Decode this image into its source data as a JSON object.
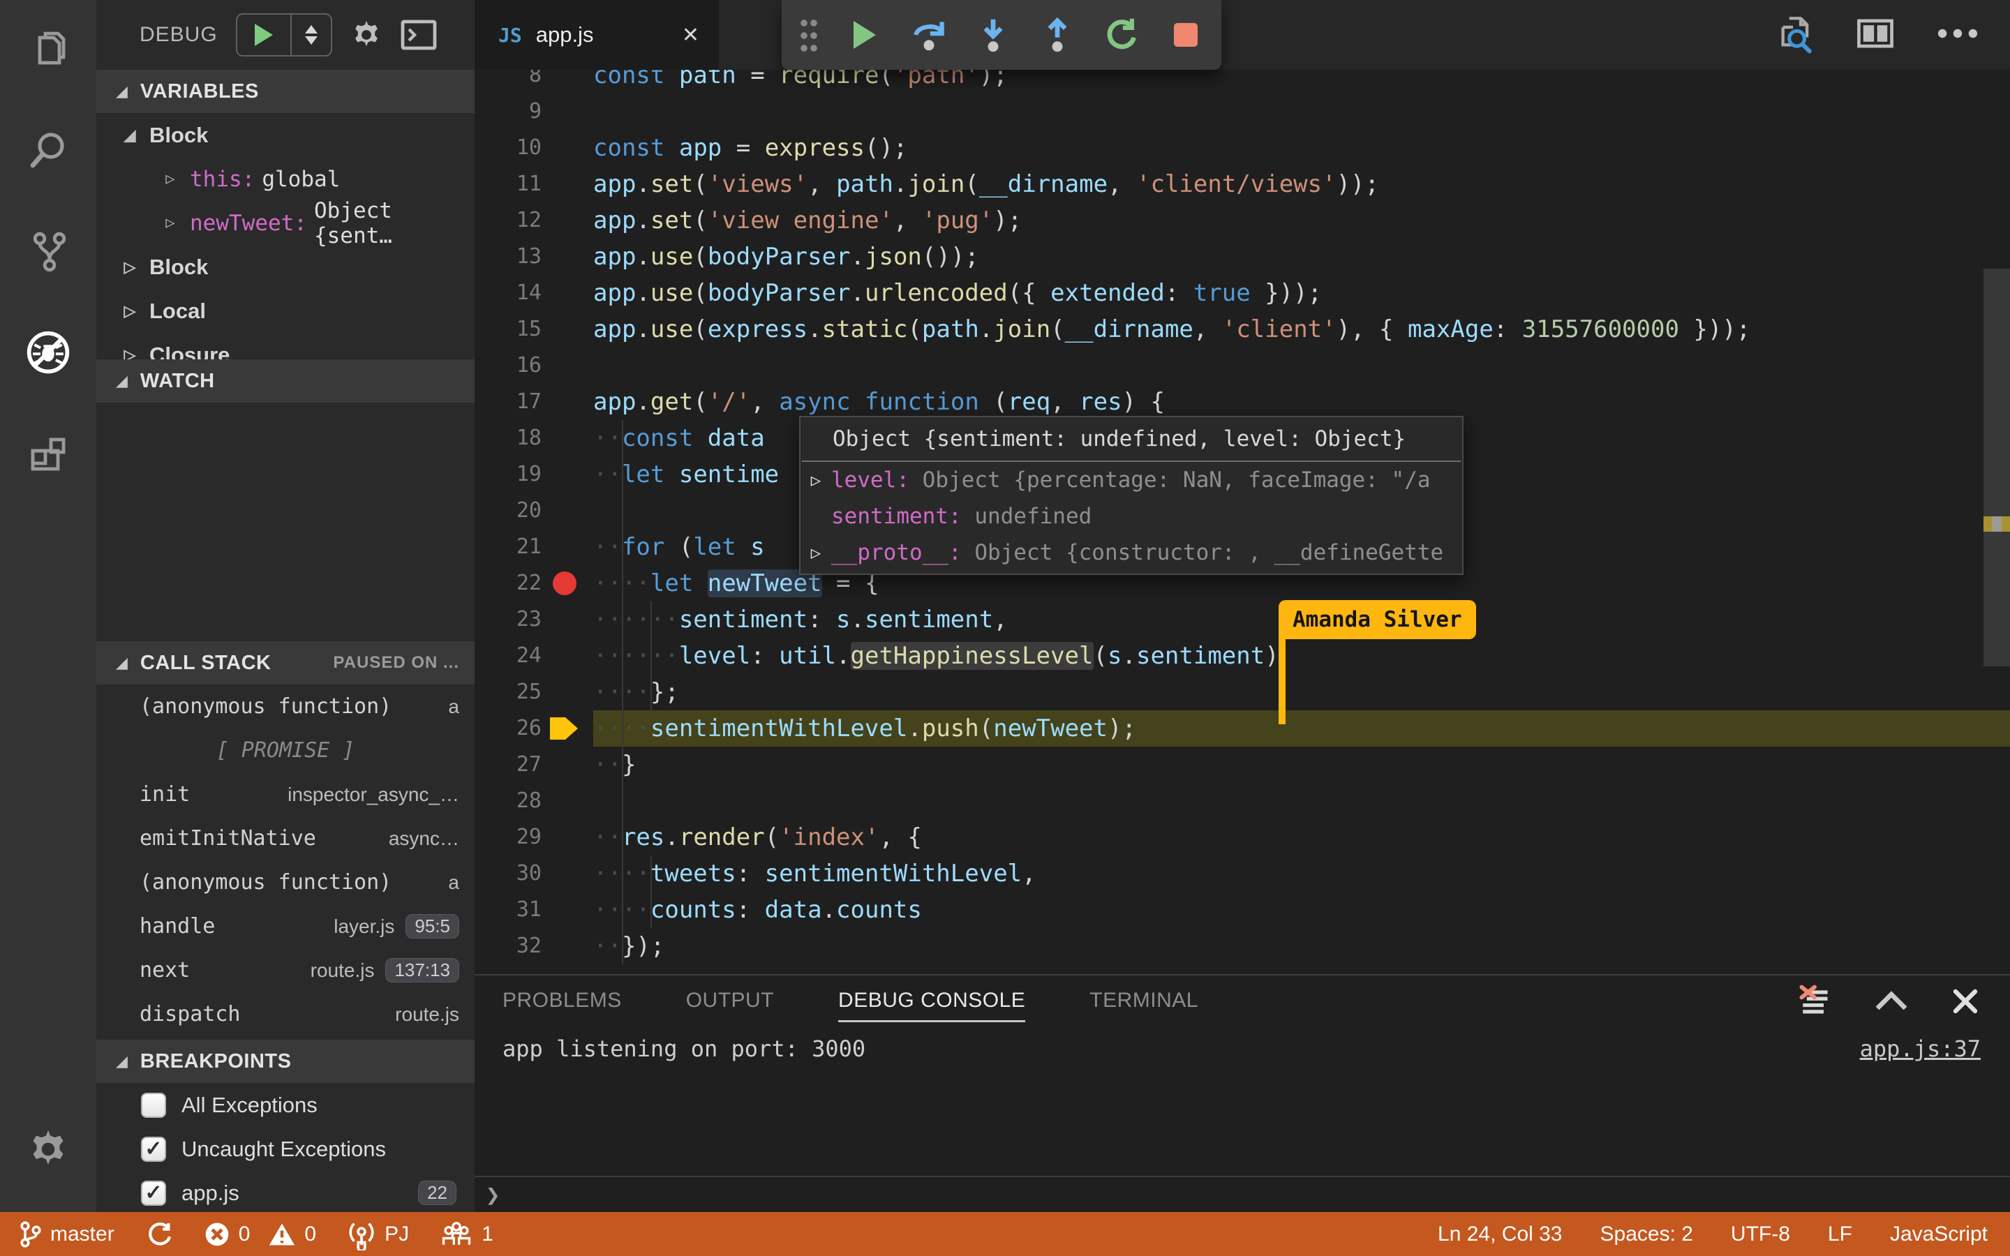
{
  "activity_bar": {
    "items": [
      {
        "icon": "files-icon"
      },
      {
        "icon": "search-icon"
      },
      {
        "icon": "source-control-icon"
      },
      {
        "icon": "debug-icon",
        "active": true
      },
      {
        "icon": "extensions-icon"
      }
    ],
    "settings_icon": "gear-icon"
  },
  "sidebar": {
    "title": "DEBUG",
    "variables": {
      "title": "VARIABLES",
      "rows": [
        {
          "type": "scope",
          "label": "Block",
          "expanded": true
        },
        {
          "type": "var",
          "name": "this:",
          "value": "global"
        },
        {
          "type": "var",
          "name": "newTweet:",
          "value": "Object {sent…"
        },
        {
          "type": "scope",
          "label": "Block",
          "expanded": false
        },
        {
          "type": "scope",
          "label": "Local",
          "expanded": false
        },
        {
          "type": "scope",
          "label": "Closure",
          "expanded": false
        }
      ]
    },
    "watch": {
      "title": "WATCH"
    },
    "call_stack": {
      "title": "CALL STACK",
      "note": "PAUSED ON ...",
      "frames": [
        {
          "name": "(anonymous function)",
          "file": "a",
          "selected": true
        },
        {
          "separator": "[ PROMISE ]"
        },
        {
          "name": "init",
          "file": "inspector_async_…"
        },
        {
          "name": "emitInitNative",
          "file": "async…"
        },
        {
          "name": "(anonymous function)",
          "file": "a"
        },
        {
          "name": "handle",
          "file": "layer.js",
          "badge": "95:5"
        },
        {
          "name": "next",
          "file": "route.js",
          "badge": "137:13"
        },
        {
          "name": "dispatch",
          "file": "route.js"
        }
      ]
    },
    "breakpoints": {
      "title": "BREAKPOINTS",
      "items": [
        {
          "label": "All Exceptions",
          "checked": false
        },
        {
          "label": "Uncaught Exceptions",
          "checked": true
        },
        {
          "label": "app.js",
          "checked": true,
          "badge": "22"
        }
      ]
    }
  },
  "editor": {
    "tab": {
      "icon": "JS",
      "label": "app.js",
      "close": "✕"
    },
    "toolbar_icons": [
      "drag-grip",
      "continue",
      "step-over",
      "step-into",
      "step-out",
      "restart",
      "stop"
    ],
    "action_icons": [
      "open-preview-icon",
      "split-editor-icon",
      "more-actions-icon"
    ],
    "breakpoint_line": 22,
    "current_line": 26,
    "collab_cursor": {
      "name": "Amanda Silver",
      "color": "#ffb710"
    },
    "hover_tooltip": {
      "title": "Object {sentiment: undefined, level: Object}",
      "rows": [
        {
          "twisty": true,
          "name": "level:",
          "value": "Object {percentage: NaN, faceImage: \"/a"
        },
        {
          "twisty": false,
          "name": "sentiment:",
          "value": "undefined"
        },
        {
          "twisty": true,
          "name": "__proto__:",
          "value": "Object {constructor: , __defineGette"
        }
      ]
    },
    "lines": [
      {
        "n": 8,
        "t": [
          [
            "k",
            "const"
          ],
          [
            "p",
            " "
          ],
          [
            "v",
            "path"
          ],
          [
            "p",
            " = "
          ],
          [
            "f",
            "require"
          ],
          [
            "p",
            "("
          ],
          [
            "s",
            "'path'"
          ],
          [
            "p",
            ");"
          ]
        ]
      },
      {
        "n": 9,
        "t": []
      },
      {
        "n": 10,
        "t": [
          [
            "k",
            "const"
          ],
          [
            "p",
            " "
          ],
          [
            "v",
            "app"
          ],
          [
            "p",
            " = "
          ],
          [
            "f",
            "express"
          ],
          [
            "p",
            "();"
          ]
        ]
      },
      {
        "n": 11,
        "t": [
          [
            "v",
            "app"
          ],
          [
            "p",
            "."
          ],
          [
            "f",
            "set"
          ],
          [
            "p",
            "("
          ],
          [
            "s",
            "'views'"
          ],
          [
            "p",
            ", "
          ],
          [
            "v",
            "path"
          ],
          [
            "p",
            "."
          ],
          [
            "f",
            "join"
          ],
          [
            "p",
            "("
          ],
          [
            "v",
            "__dirname"
          ],
          [
            "p",
            ", "
          ],
          [
            "s",
            "'client/views'"
          ],
          [
            "p",
            "));"
          ]
        ]
      },
      {
        "n": 12,
        "t": [
          [
            "v",
            "app"
          ],
          [
            "p",
            "."
          ],
          [
            "f",
            "set"
          ],
          [
            "p",
            "("
          ],
          [
            "s",
            "'view engine'"
          ],
          [
            "p",
            ", "
          ],
          [
            "s",
            "'pug'"
          ],
          [
            "p",
            ");"
          ]
        ]
      },
      {
        "n": 13,
        "t": [
          [
            "v",
            "app"
          ],
          [
            "p",
            "."
          ],
          [
            "f",
            "use"
          ],
          [
            "p",
            "("
          ],
          [
            "v",
            "bodyParser"
          ],
          [
            "p",
            "."
          ],
          [
            "f",
            "json"
          ],
          [
            "p",
            "());"
          ]
        ]
      },
      {
        "n": 14,
        "t": [
          [
            "v",
            "app"
          ],
          [
            "p",
            "."
          ],
          [
            "f",
            "use"
          ],
          [
            "p",
            "("
          ],
          [
            "v",
            "bodyParser"
          ],
          [
            "p",
            "."
          ],
          [
            "f",
            "urlencoded"
          ],
          [
            "p",
            "({ "
          ],
          [
            "v",
            "extended"
          ],
          [
            "p",
            ": "
          ],
          [
            "k",
            "true"
          ],
          [
            "p",
            " }));"
          ]
        ]
      },
      {
        "n": 15,
        "t": [
          [
            "v",
            "app"
          ],
          [
            "p",
            "."
          ],
          [
            "f",
            "use"
          ],
          [
            "p",
            "("
          ],
          [
            "v",
            "express"
          ],
          [
            "p",
            "."
          ],
          [
            "f",
            "static"
          ],
          [
            "p",
            "("
          ],
          [
            "v",
            "path"
          ],
          [
            "p",
            "."
          ],
          [
            "f",
            "join"
          ],
          [
            "p",
            "("
          ],
          [
            "v",
            "__dirname"
          ],
          [
            "p",
            ", "
          ],
          [
            "s",
            "'client'"
          ],
          [
            "p",
            "), { "
          ],
          [
            "v",
            "maxAge"
          ],
          [
            "p",
            ": "
          ],
          [
            "n",
            "31557600000"
          ],
          [
            "p",
            " }));"
          ]
        ]
      },
      {
        "n": 16,
        "t": []
      },
      {
        "n": 17,
        "t": [
          [
            "v",
            "app"
          ],
          [
            "p",
            "."
          ],
          [
            "f",
            "get"
          ],
          [
            "p",
            "("
          ],
          [
            "s",
            "'/'"
          ],
          [
            "p",
            ", "
          ],
          [
            "k",
            "async"
          ],
          [
            "p",
            " "
          ],
          [
            "k",
            "function"
          ],
          [
            "p",
            " ("
          ],
          [
            "v",
            "req"
          ],
          [
            "p",
            ", "
          ],
          [
            "v",
            "res"
          ],
          [
            "p",
            ") {"
          ]
        ]
      },
      {
        "n": 18,
        "t": [
          [
            "w",
            "··"
          ],
          [
            "k",
            "const"
          ],
          [
            "p",
            " "
          ],
          [
            "v",
            "data"
          ]
        ]
      },
      {
        "n": 19,
        "t": [
          [
            "w",
            "··"
          ],
          [
            "k",
            "let"
          ],
          [
            "p",
            " "
          ],
          [
            "v",
            "sentime"
          ]
        ]
      },
      {
        "n": 20,
        "t": []
      },
      {
        "n": 21,
        "t": [
          [
            "w",
            "··"
          ],
          [
            "k",
            "for"
          ],
          [
            "p",
            " ("
          ],
          [
            "k",
            "let"
          ],
          [
            "p",
            " "
          ],
          [
            "v",
            "s"
          ]
        ]
      },
      {
        "n": 22,
        "t": [
          [
            "w",
            "····"
          ],
          [
            "k",
            "let"
          ],
          [
            "p",
            " "
          ],
          [
            "v",
            "newTweet",
            "word"
          ],
          [
            "p",
            " = {"
          ]
        ]
      },
      {
        "n": 23,
        "t": [
          [
            "w",
            "······"
          ],
          [
            "v",
            "sentiment"
          ],
          [
            "p",
            ": "
          ],
          [
            "v",
            "s"
          ],
          [
            "p",
            "."
          ],
          [
            "v",
            "sentiment"
          ],
          [
            "p",
            ","
          ]
        ]
      },
      {
        "n": 24,
        "t": [
          [
            "w",
            "······"
          ],
          [
            "v",
            "level"
          ],
          [
            "p",
            ": "
          ],
          [
            "v",
            "util"
          ],
          [
            "p",
            "."
          ],
          [
            "f",
            "getHappinessLevel",
            "hover"
          ],
          [
            "p",
            "("
          ],
          [
            "v",
            "s"
          ],
          [
            "p",
            "."
          ],
          [
            "v",
            "sentiment"
          ],
          [
            "p",
            ")"
          ]
        ]
      },
      {
        "n": 25,
        "t": [
          [
            "w",
            "····"
          ],
          [
            "p",
            "};"
          ]
        ]
      },
      {
        "n": 26,
        "t": [
          [
            "w",
            "····"
          ],
          [
            "v",
            "sentimentWithLevel"
          ],
          [
            "p",
            "."
          ],
          [
            "f",
            "push"
          ],
          [
            "p",
            "("
          ],
          [
            "v",
            "newTweet"
          ],
          [
            "p",
            ");"
          ]
        ]
      },
      {
        "n": 27,
        "t": [
          [
            "w",
            "··"
          ],
          [
            "p",
            "}"
          ]
        ]
      },
      {
        "n": 28,
        "t": []
      },
      {
        "n": 29,
        "t": [
          [
            "w",
            "··"
          ],
          [
            "v",
            "res"
          ],
          [
            "p",
            "."
          ],
          [
            "f",
            "render"
          ],
          [
            "p",
            "("
          ],
          [
            "s",
            "'index'"
          ],
          [
            "p",
            ", {"
          ]
        ]
      },
      {
        "n": 30,
        "t": [
          [
            "w",
            "····"
          ],
          [
            "v",
            "tweets"
          ],
          [
            "p",
            ": "
          ],
          [
            "v",
            "sentimentWithLevel"
          ],
          [
            "p",
            ","
          ]
        ]
      },
      {
        "n": 31,
        "t": [
          [
            "w",
            "····"
          ],
          [
            "v",
            "counts"
          ],
          [
            "p",
            ": "
          ],
          [
            "v",
            "data"
          ],
          [
            "p",
            "."
          ],
          [
            "v",
            "counts"
          ]
        ]
      },
      {
        "n": 32,
        "t": [
          [
            "w",
            "··"
          ],
          [
            "p",
            "});"
          ]
        ]
      }
    ]
  },
  "panel": {
    "tabs": [
      {
        "label": "PROBLEMS"
      },
      {
        "label": "OUTPUT"
      },
      {
        "label": "DEBUG CONSOLE",
        "active": true
      },
      {
        "label": "TERMINAL"
      }
    ],
    "action_icons": [
      "clear-console-icon",
      "maximize-panel-icon",
      "close-panel-icon"
    ],
    "console_text": "app listening on port: 3000",
    "source_link": "app.js:37",
    "prompt": "❯"
  },
  "status_bar": {
    "background": "#c4581f",
    "branch": "master",
    "errors": "0",
    "warnings": "0",
    "live_share": "PJ",
    "participants": "1",
    "cursor": "Ln 24, Col 33",
    "indent": "Spaces: 2",
    "encoding": "UTF-8",
    "eol": "LF",
    "language": "JavaScript"
  }
}
